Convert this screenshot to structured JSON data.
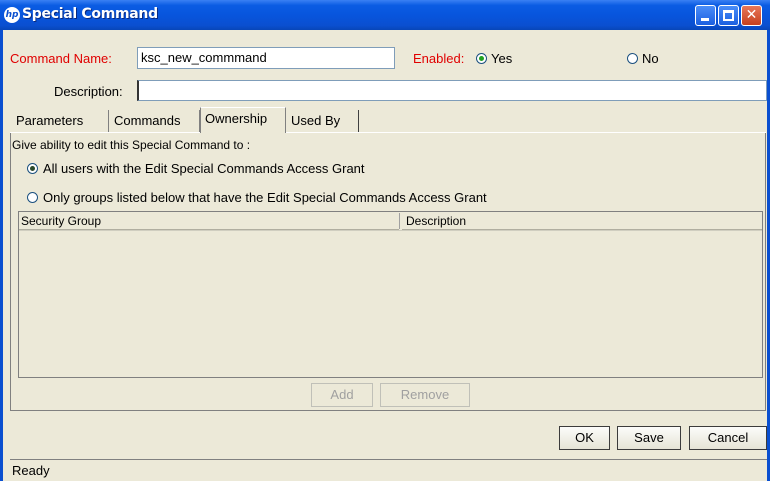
{
  "window": {
    "title": "Special Command",
    "logo_text": "hp",
    "min_icon": "minimize-icon",
    "max_icon": "maximize-icon",
    "close_glyph": "✕"
  },
  "form": {
    "command_name_label": "Command Name:",
    "command_name_value": "ksc_new_commmand",
    "enabled_label": "Enabled:",
    "yes_label": "Yes",
    "no_label": "No",
    "enabled_value": "Yes",
    "description_label": "Description:",
    "description_value": ""
  },
  "tabs": [
    {
      "label": "Parameters"
    },
    {
      "label": "Commands"
    },
    {
      "label": "Ownership"
    },
    {
      "label": "Used By"
    }
  ],
  "active_tab": "Ownership",
  "ownership": {
    "heading": "Give ability to edit this Special Command to :",
    "option_all": "All users with the Edit Special Commands Access Grant",
    "option_groups": "Only groups listed below that have the Edit Special Commands Access Grant",
    "selected": "all",
    "columns": [
      "Security Group",
      "Description"
    ],
    "rows": [],
    "add_label": "Add",
    "remove_label": "Remove"
  },
  "footer": {
    "ok_label": "OK",
    "save_label": "Save",
    "cancel_label": "Cancel"
  },
  "status": {
    "text": "Ready"
  },
  "colors": {
    "title_bar": "#0a4fd0",
    "required_label": "#e00000",
    "window_bg": "#ece9d8"
  }
}
